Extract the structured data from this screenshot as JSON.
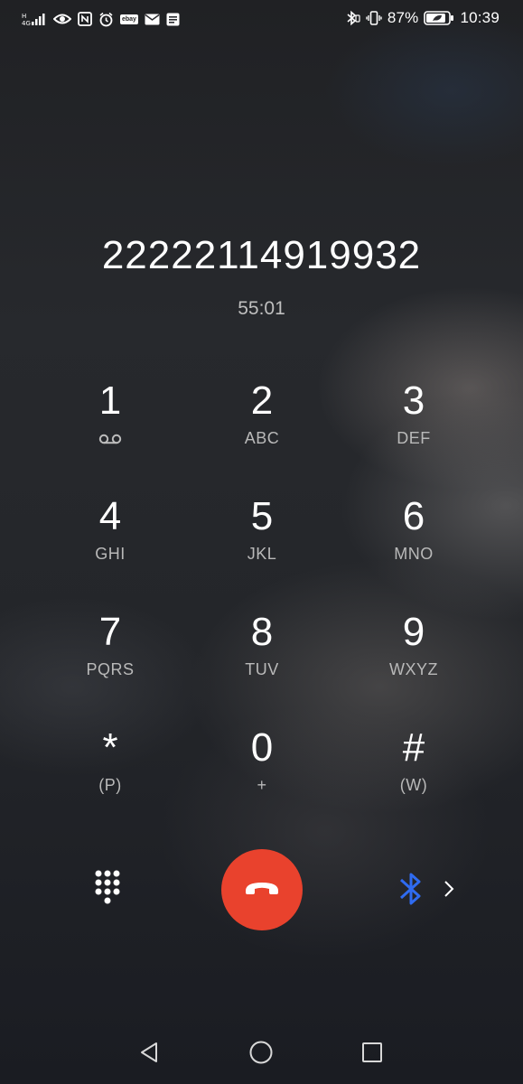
{
  "status_bar": {
    "battery_percent": "87%",
    "time": "10:39",
    "battery_level": 0.87,
    "left_icons": [
      "signal-icon",
      "eye-icon",
      "nfc-icon",
      "alarm-icon",
      "ebay-icon",
      "mail-icon",
      "notification-icon"
    ],
    "ebay_label": "ebay"
  },
  "call": {
    "number": "22222114919932",
    "timer": "55:01"
  },
  "keypad": {
    "keys": [
      {
        "digit": "1",
        "letters": ""
      },
      {
        "digit": "2",
        "letters": "ABC"
      },
      {
        "digit": "3",
        "letters": "DEF"
      },
      {
        "digit": "4",
        "letters": "GHI"
      },
      {
        "digit": "5",
        "letters": "JKL"
      },
      {
        "digit": "6",
        "letters": "MNO"
      },
      {
        "digit": "7",
        "letters": "PQRS"
      },
      {
        "digit": "8",
        "letters": "TUV"
      },
      {
        "digit": "9",
        "letters": "WXYZ"
      },
      {
        "digit": "*",
        "letters": "(P)"
      },
      {
        "digit": "0",
        "letters": "+"
      },
      {
        "digit": "#",
        "letters": "(W)"
      }
    ]
  },
  "controls": {
    "hangup_color": "#e9422d",
    "bluetooth_color": "#2f6bf0"
  },
  "nav": {
    "buttons": [
      "back-icon",
      "home-icon",
      "recents-icon"
    ]
  }
}
